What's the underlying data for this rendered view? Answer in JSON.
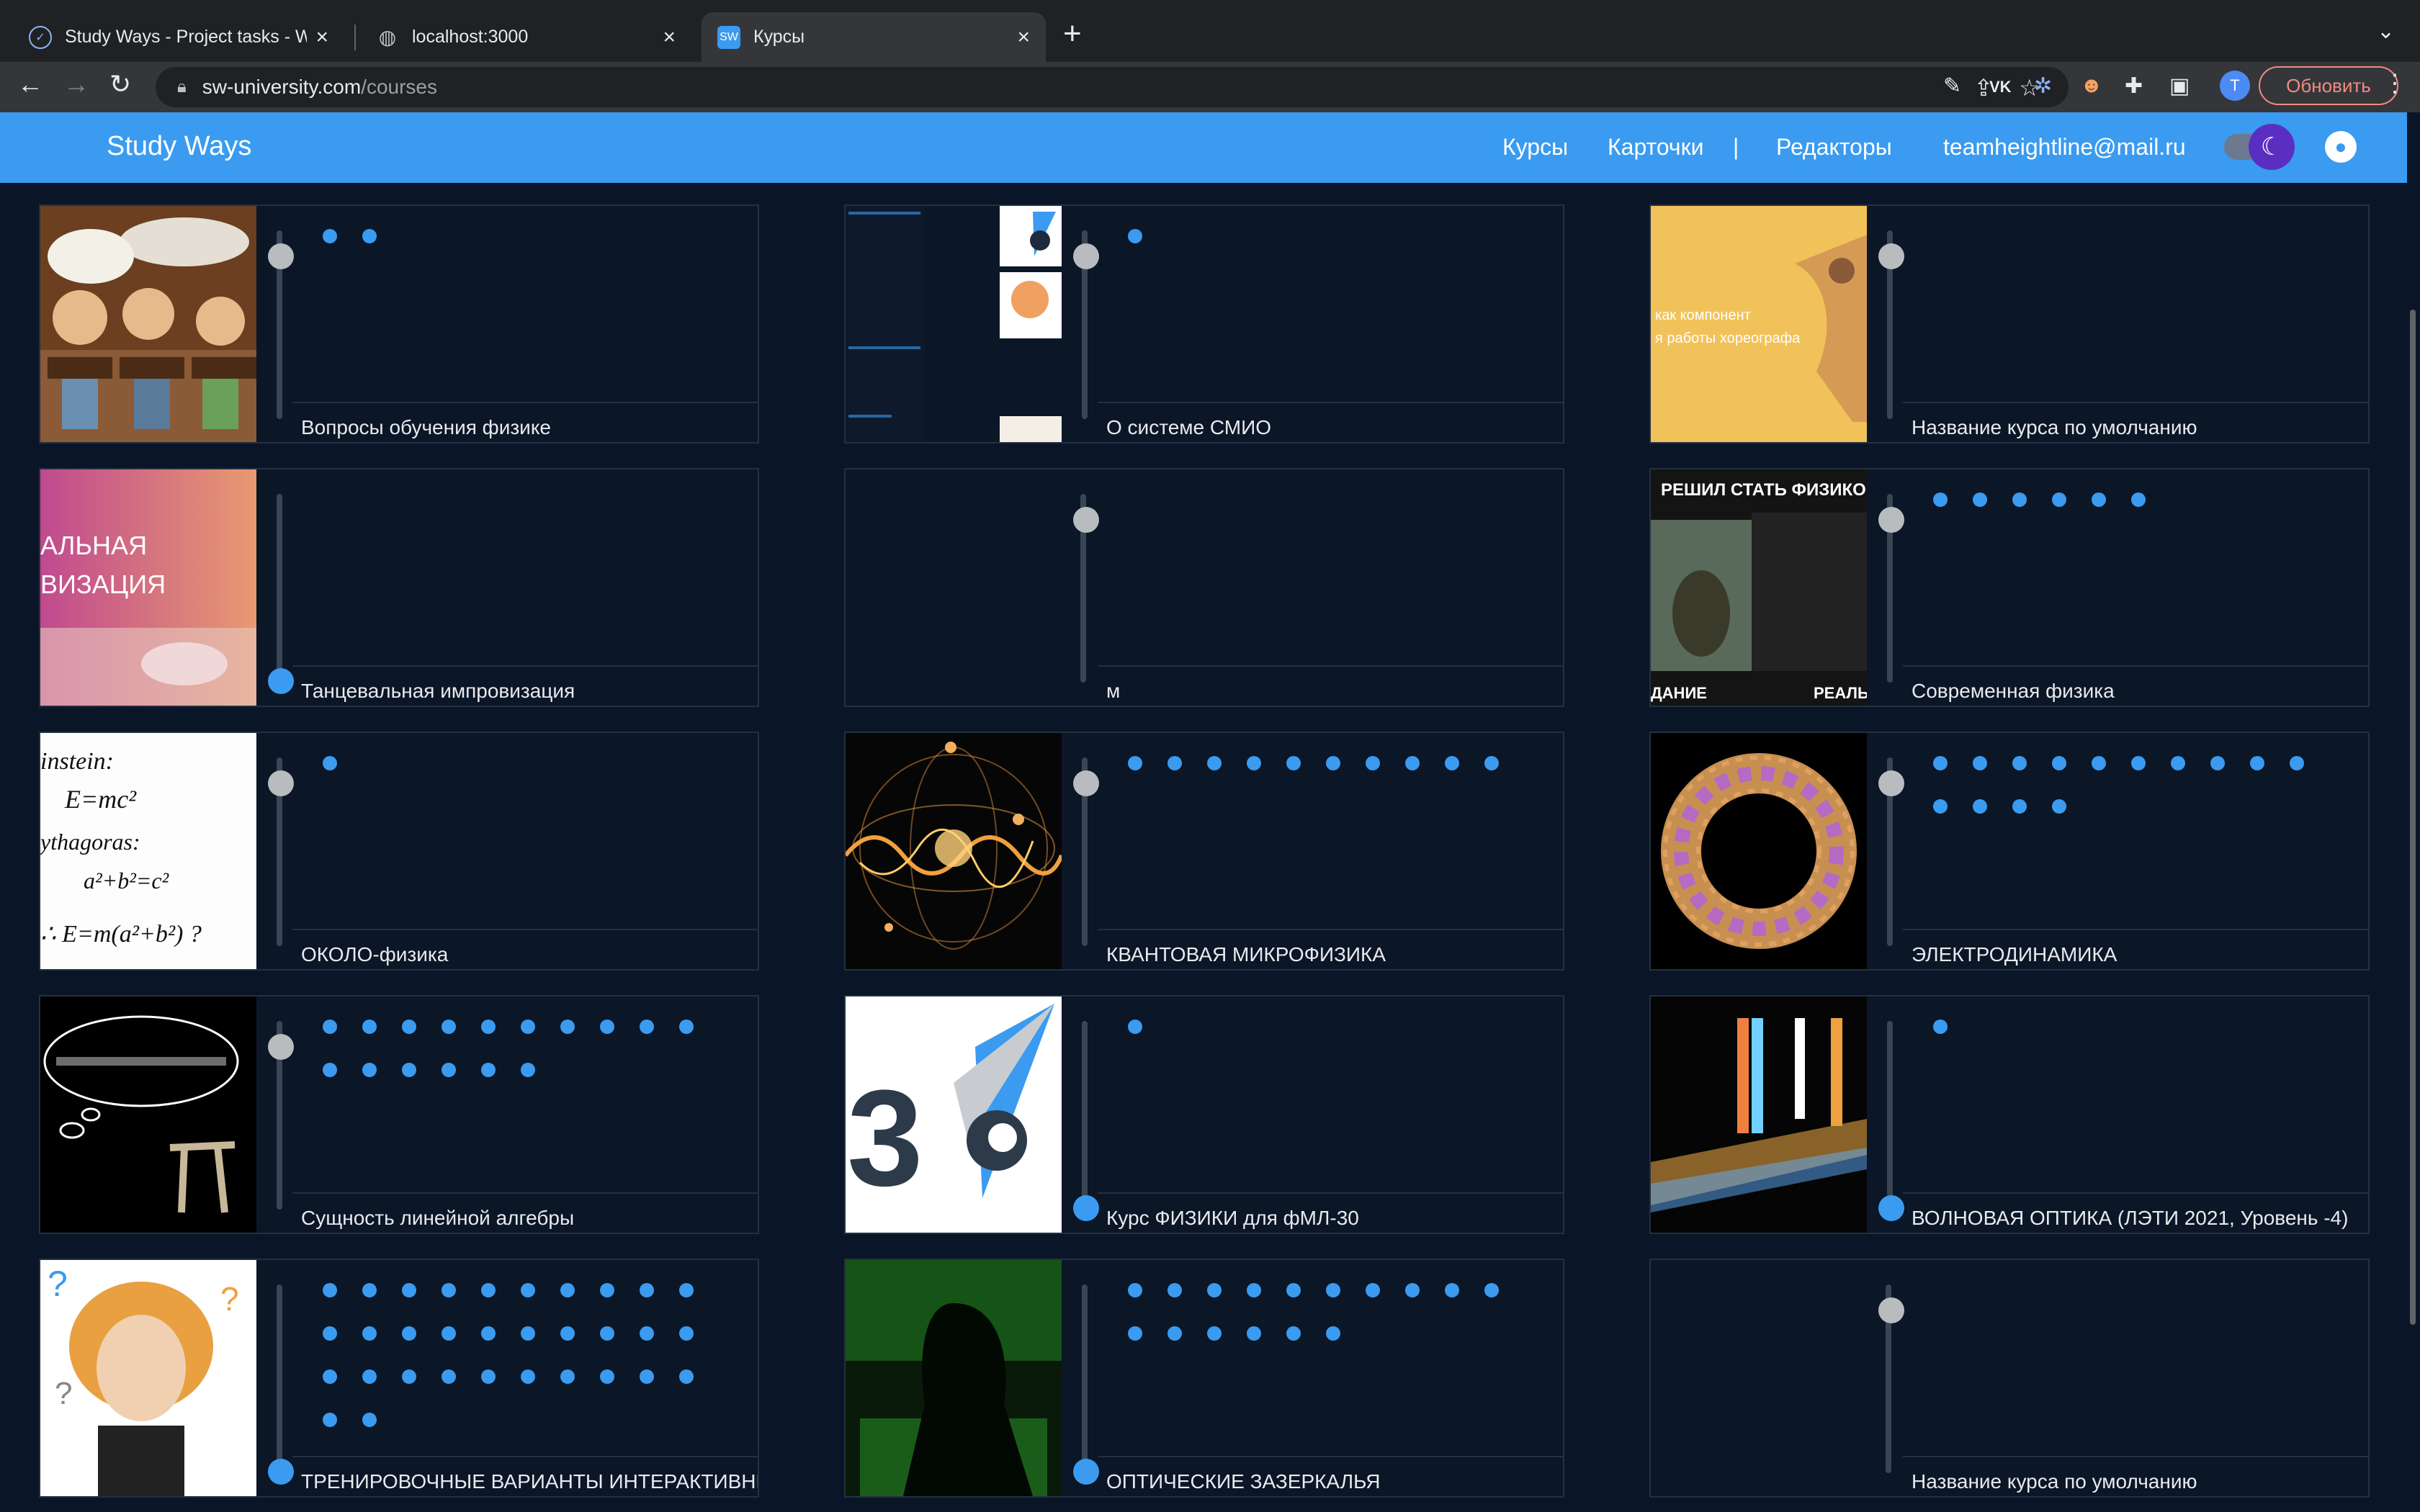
{
  "browser": {
    "tabs": [
      {
        "label": "Study Ways - Project tasks - W",
        "icon": "check-circle-icon",
        "active": false
      },
      {
        "label": "localhost:3000",
        "icon": "globe-icon",
        "active": false
      },
      {
        "label": "Курсы",
        "icon": "sw-favicon",
        "active": true
      }
    ],
    "url_host": "sw-university.com",
    "url_path": "/courses",
    "profile_initial": "T",
    "update_label": "Обновить",
    "vk_label": "VK"
  },
  "app": {
    "brand": "Study Ways",
    "menu": {
      "courses": "Курсы",
      "cards": "Карточки",
      "separator": "|",
      "editors": "Редакторы",
      "email": "teamheightline@mail.ru"
    },
    "accent": "#3a9bf0",
    "background": "#0a1628"
  },
  "thumbs": {
    "meme_top": "РЕШИЛ СТАТЬ ФИЗИКОМ",
    "meme_bottom_left": "ДАНИЕ",
    "meme_bottom_right": "РЕАЛЬ",
    "dance_line1": "АЛЬНАЯ",
    "dance_line2": "ВИЗАЦИЯ",
    "choreo_line1": "как компонент",
    "choreo_line2": "я работы хореографа",
    "einstein_line1": "instein:",
    "einstein_line2": "E=mc²",
    "einstein_line3": "ythagoras:",
    "einstein_line4": "a²+b²=c²",
    "einstein_line5": "∴ E=m(a²+b²) ?",
    "logo_text": "3"
  },
  "courses": [
    {
      "title": "Вопросы обучения физике",
      "dots": 2,
      "thumb": "classroom-cartoon",
      "knob": "top-grey"
    },
    {
      "title": "О системе СМИО",
      "dots": 1,
      "thumb": "smio-collage",
      "knob": "top-grey"
    },
    {
      "title": "Название курса по умолчанию",
      "dots": 0,
      "thumb": "choreography",
      "knob": "top-grey"
    },
    {
      "title": "Танцевальная импровизация",
      "dots": 0,
      "thumb": "dance",
      "knob": "bottom-blue"
    },
    {
      "title": "м",
      "dots": 0,
      "thumb": "none",
      "knob": "top-grey"
    },
    {
      "title": "Современная физика",
      "dots": 6,
      "thumb": "physics-meme",
      "knob": "top-grey"
    },
    {
      "title": "ОКОЛО-физика",
      "dots": 1,
      "thumb": "einstein-note",
      "knob": "top-grey"
    },
    {
      "title": "КВАНТОВАЯ МИКРОФИЗИКА",
      "dots": 10,
      "thumb": "quantum-orbits",
      "knob": "top-grey"
    },
    {
      "title": "ЭЛЕКТРОДИНАМИКА",
      "dots": 14,
      "thumb": "torus-coil",
      "knob": "top-grey"
    },
    {
      "title": "Сущность линейной алгебры",
      "dots": 16,
      "thumb": "pi-thinking",
      "knob": "top-grey"
    },
    {
      "title": "Курс ФИЗИКИ для фМЛ-30",
      "dots": 1,
      "thumb": "school-logo",
      "knob": "bottom-blue"
    },
    {
      "title": "ВОЛНОВАЯ ОПТИКА (ЛЭТИ 2021, Уровень -4)",
      "dots": 1,
      "thumb": "light-prism",
      "knob": "bottom-blue"
    },
    {
      "title": "ТРЕНИРОВОЧНЫЕ ВАРИАНТЫ ИНТЕРАКТИВНЫ",
      "dots": 32,
      "thumb": "confused-girl",
      "knob": "bottom-blue"
    },
    {
      "title": "ОПТИЧЕСКИЕ ЗАЗЕРКАЛЬЯ",
      "dots": 16,
      "thumb": "green-hacker",
      "knob": "bottom-blue"
    },
    {
      "title": "Название курса по умолчанию",
      "dots": 0,
      "thumb": "none",
      "knob": "top-grey"
    }
  ]
}
